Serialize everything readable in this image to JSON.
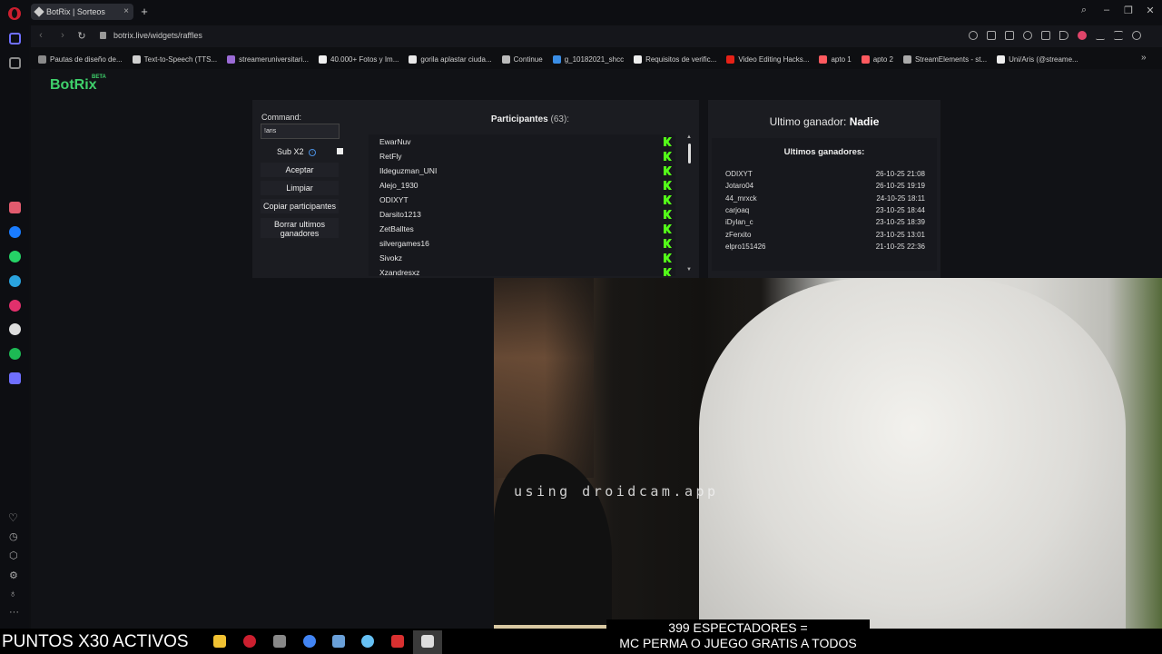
{
  "browser": {
    "tab_title": "BotRix | Sorteos",
    "tab_close": "×",
    "new_tab": "+",
    "url": "botrix.live/widgets/raffles",
    "window_controls": [
      "⌕",
      "–",
      "❐",
      "✕"
    ],
    "nav": {
      "back": "‹",
      "forward": "›",
      "reload": "↻"
    }
  },
  "bookmarks": [
    {
      "label": "Pautas de diseño de...",
      "color": "#8a8a8a"
    },
    {
      "label": "Text-to-Speech (TTS...",
      "color": "#d0d0d0"
    },
    {
      "label": "streameruniversitari...",
      "color": "#9b6bd6"
    },
    {
      "label": "40.000+ Fotos y Im...",
      "color": "#f0f0f0"
    },
    {
      "label": "gorila aplastar ciuda...",
      "color": "#e8e8e8"
    },
    {
      "label": "Continue",
      "color": "#bbbbbb"
    },
    {
      "label": "g_10182021_shcc",
      "color": "#3a8ee6"
    },
    {
      "label": "Requisitos de verific...",
      "color": "#eeeeee"
    },
    {
      "label": "Video Editing Hacks...",
      "color": "#e62117"
    },
    {
      "label": "apto 1",
      "color": "#ff5a5f"
    },
    {
      "label": "apto 2",
      "color": "#ff5a5f"
    },
    {
      "label": "StreamElements - st...",
      "color": "#aaaaaa"
    },
    {
      "label": "Uni/Aris (@streame...",
      "color": "#eeeeee"
    }
  ],
  "bookmarks_more": "»",
  "sidebar_icons": [
    {
      "name": "home-icon",
      "color": "#6f6fff"
    },
    {
      "name": "star-icon",
      "color": "#8a8a8a"
    },
    {
      "name": "aria-icon",
      "color": "#e15b6e"
    },
    {
      "name": "messenger-icon",
      "color": "#1a7cff"
    },
    {
      "name": "whatsapp-icon",
      "color": "#25d366"
    },
    {
      "name": "telegram-icon",
      "color": "#2aa3de"
    },
    {
      "name": "instagram-icon",
      "color": "#e1306c"
    },
    {
      "name": "x-icon",
      "color": "#dddddd"
    },
    {
      "name": "spotify-icon",
      "color": "#1db954"
    },
    {
      "name": "player-icon",
      "color": "#6f6fff"
    }
  ],
  "botrix": {
    "logo": "BotRix",
    "beta": "BETA",
    "command_label": "Command:",
    "command_value": "!aris",
    "sub_label": "Sub X2",
    "info_glyph": "i",
    "buttons": {
      "accept": "Aceptar",
      "clear": "Limpiar",
      "copy": "Copiar participantes",
      "delete_winners": "Borrar ultimos ganadores"
    },
    "participants_title": "Participantes",
    "participants_count": "(63):",
    "participants": [
      "EwarNuv",
      "RetFly",
      "Ildeguzman_UNI",
      "Alejo_1930",
      "ODIXYT",
      "Darsito1213",
      "ZetBalltes",
      "silvergames16",
      "Sivokz",
      "Xzandresxz"
    ],
    "scroll_up": "▲",
    "scroll_down": "▼",
    "last_winner_label": "Ultimo ganador:",
    "last_winner_name": "Nadie",
    "winners_heading": "Ultimos ganadores:",
    "winners": [
      {
        "name": "ODIXYT",
        "date": "26-10-25 21:08"
      },
      {
        "name": "Jotaro04",
        "date": "26-10-25 19:19"
      },
      {
        "name": "44_mrxck",
        "date": "24-10-25 18:11"
      },
      {
        "name": "carjoaq",
        "date": "23-10-25 18:44"
      },
      {
        "name": "iDylan_c",
        "date": "23-10-25 18:39"
      },
      {
        "name": "zFerxito",
        "date": "23-10-25 13:01"
      },
      {
        "name": "elpro151426",
        "date": "21-10-25 22:36"
      }
    ]
  },
  "stream": {
    "watermark": "using droidcam.app",
    "points_banner": "PUNTOS X30 ACTIVOS",
    "spectators_line1": "399 ESPECTADORES =",
    "spectators_line2": "MC PERMA O JUEGO GRATIS A TODOS"
  },
  "taskbar_icons": [
    {
      "name": "file-explorer-icon",
      "color": "#f1c232"
    },
    {
      "name": "opera-icon",
      "color": "#cc1f2f"
    },
    {
      "name": "app-icon",
      "color": "#888888"
    },
    {
      "name": "chrome-icon",
      "color": "#4285f4"
    },
    {
      "name": "window-icon",
      "color": "#6aa0d8"
    },
    {
      "name": "steam-icon",
      "color": "#66c0f4"
    },
    {
      "name": "red-app-icon",
      "color": "#d93030"
    },
    {
      "name": "obs-icon",
      "color": "#dddddd"
    }
  ]
}
